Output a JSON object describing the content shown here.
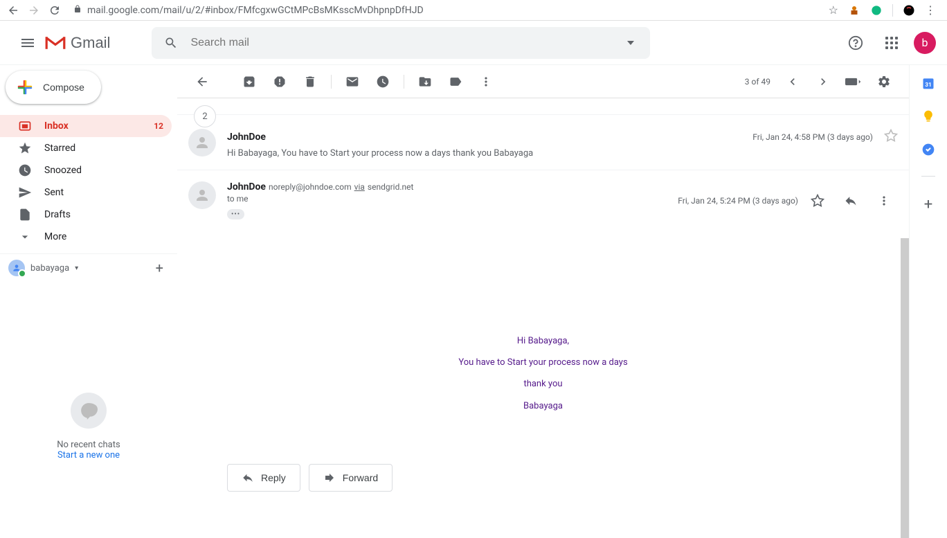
{
  "browser": {
    "url": "mail.google.com/mail/u/2/#inbox/FMfcgxwGCtMPcBsMKsscMvDhpnpDfHJD"
  },
  "header": {
    "logo_text": "Gmail",
    "search_placeholder": "Search mail",
    "avatar_initial": "b"
  },
  "sidebar": {
    "compose_label": "Compose",
    "items": [
      {
        "label": "Inbox",
        "count": "12",
        "icon": "inbox"
      },
      {
        "label": "Starred",
        "icon": "star"
      },
      {
        "label": "Snoozed",
        "icon": "clock"
      },
      {
        "label": "Sent",
        "icon": "send"
      },
      {
        "label": "Drafts",
        "icon": "file"
      },
      {
        "label": "More",
        "icon": "chevron"
      }
    ],
    "contact_name": "babayaga",
    "hangouts_no_chats": "No recent chats",
    "hangouts_start": "Start a new one"
  },
  "toolbar": {
    "page_info": "3 of 49"
  },
  "thread": {
    "count": "2",
    "collapsed": {
      "sender": "JohnDoe",
      "date": "Fri, Jan 24, 4:58 PM (3 days ago)",
      "snippet": "Hi Babayaga, You have to Start your process now a days thank you Babayaga"
    },
    "expanded": {
      "sender": "JohnDoe",
      "email": "noreply@johndoe.com",
      "via_label": "via",
      "via_domain": "sendgrid.net",
      "date": "Fri, Jan 24, 5:24 PM (3 days ago)",
      "to_label": "to me",
      "body_lines": [
        "Hi Babayaga,",
        "You have to Start your process now a days",
        "thank you",
        "Babayaga"
      ]
    }
  },
  "actions": {
    "reply_label": "Reply",
    "forward_label": "Forward"
  }
}
